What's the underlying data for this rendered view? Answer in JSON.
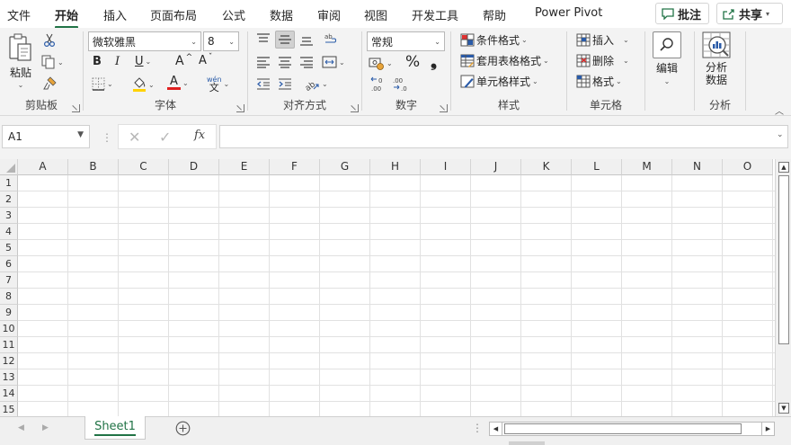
{
  "menu": {
    "tabs": [
      "文件",
      "开始",
      "插入",
      "页面布局",
      "公式",
      "数据",
      "审阅",
      "视图",
      "开发工具",
      "帮助",
      "Power Pivot"
    ],
    "active": "开始",
    "comments_label": "批注",
    "share_label": "共享"
  },
  "ribbon": {
    "clipboard": {
      "label": "剪贴板",
      "paste": "粘贴"
    },
    "font": {
      "label": "字体",
      "font_name": "微软雅黑",
      "font_size": "8",
      "bold": "B",
      "italic": "I",
      "underline": "U",
      "grow": "A",
      "shrink": "A",
      "color_a": "A",
      "phonetic_top": "wén",
      "phonetic": "文"
    },
    "alignment": {
      "label": "对齐方式"
    },
    "number": {
      "label": "数字",
      "format": "常规",
      "percent": "%",
      "comma": "❟"
    },
    "styles": {
      "label": "样式",
      "conditional": "条件格式",
      "table": "套用表格格式",
      "cell_styles": "单元格样式"
    },
    "cells": {
      "label": "单元格",
      "insert": "插入",
      "delete": "删除",
      "format": "格式"
    },
    "editing": {
      "label": "编辑"
    },
    "analysis": {
      "label": "分析",
      "analyze_line1": "分析",
      "analyze_line2": "数据"
    }
  },
  "formula_bar": {
    "name_box": "A1",
    "fx": "fx",
    "value": ""
  },
  "grid": {
    "columns": [
      "A",
      "B",
      "C",
      "D",
      "E",
      "F",
      "G",
      "H",
      "I",
      "J",
      "K",
      "L",
      "M",
      "N",
      "O"
    ],
    "rows": [
      "1",
      "2",
      "3",
      "4",
      "5",
      "6",
      "7",
      "8",
      "9",
      "10",
      "11",
      "12",
      "13",
      "14",
      "15"
    ]
  },
  "sheets": {
    "tabs": [
      "Sheet1"
    ],
    "active": "Sheet1"
  },
  "colors": {
    "accent": "#217346",
    "ribbon_bg": "#f3f3f3",
    "fill": "#ffd200",
    "font_red": "#e02020"
  }
}
